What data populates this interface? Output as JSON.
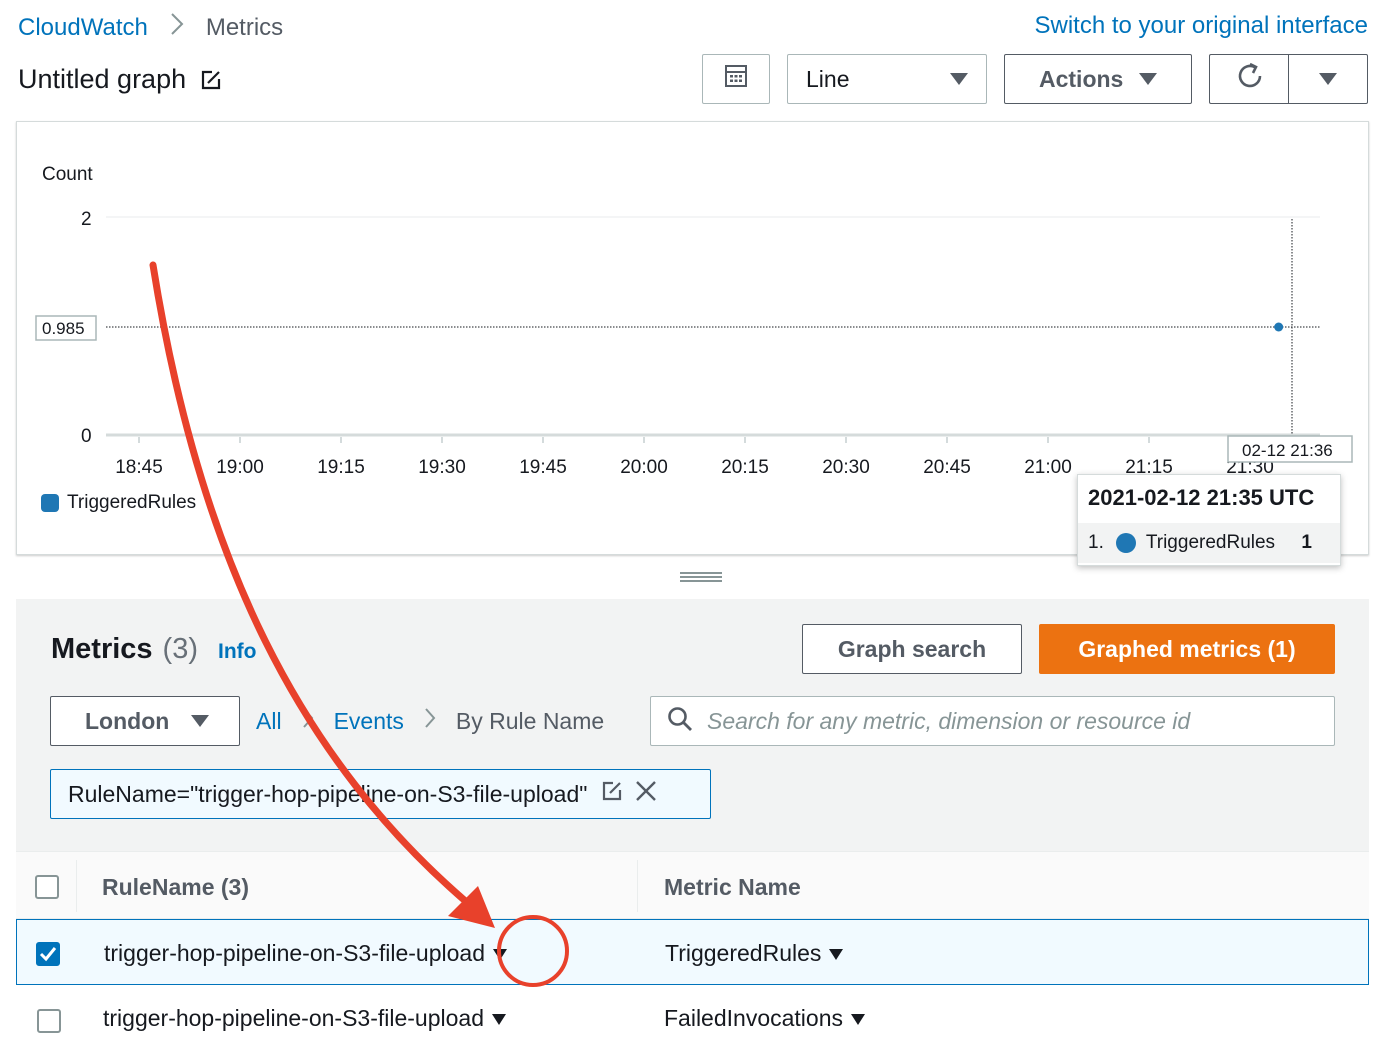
{
  "breadcrumb": {
    "root": "CloudWatch",
    "current": "Metrics"
  },
  "switch_link": "Switch to your original interface",
  "graph_title": "Untitled graph",
  "toolbar": {
    "chart_type": "Line",
    "actions_label": "Actions"
  },
  "chart_data": {
    "type": "line",
    "ylabel": "Count",
    "ylim": [
      0,
      2
    ],
    "y_ticks": [
      "2",
      "0"
    ],
    "x_ticks": [
      "18:45",
      "19:00",
      "19:15",
      "19:30",
      "19:45",
      "20:00",
      "20:15",
      "20:30",
      "20:45",
      "21:00",
      "21:15",
      "21:30"
    ],
    "crosshair_y_label": "0.985",
    "crosshair_x_label": "02-12 21:36",
    "series": [
      {
        "name": "TriggeredRules",
        "color": "#1f77b4",
        "points": [
          {
            "x": "21:35",
            "y": 1
          }
        ]
      }
    ]
  },
  "tooltip": {
    "title": "2021-02-12 21:35 UTC",
    "index": "1.",
    "series": "TriggeredRules",
    "value": "1"
  },
  "metrics": {
    "heading": "Metrics",
    "count": "(3)",
    "info": "Info",
    "graph_search": "Graph search",
    "graphed_metrics": "Graphed metrics (1)",
    "region": "London",
    "crumbs": {
      "all": "All",
      "events": "Events",
      "current": "By Rule Name"
    },
    "search_placeholder": "Search for any metric, dimension or resource id",
    "filter": "RuleName=\"trigger-hop-pipeline-on-S3-file-upload\"",
    "table": {
      "col_rule": "RuleName  (3)",
      "col_metric": "Metric Name",
      "rows": [
        {
          "rule": "trigger-hop-pipeline-on-S3-file-upload",
          "metric": "TriggeredRules",
          "checked": true
        },
        {
          "rule": "trigger-hop-pipeline-on-S3-file-upload",
          "metric": "FailedInvocations",
          "checked": false
        }
      ]
    }
  }
}
